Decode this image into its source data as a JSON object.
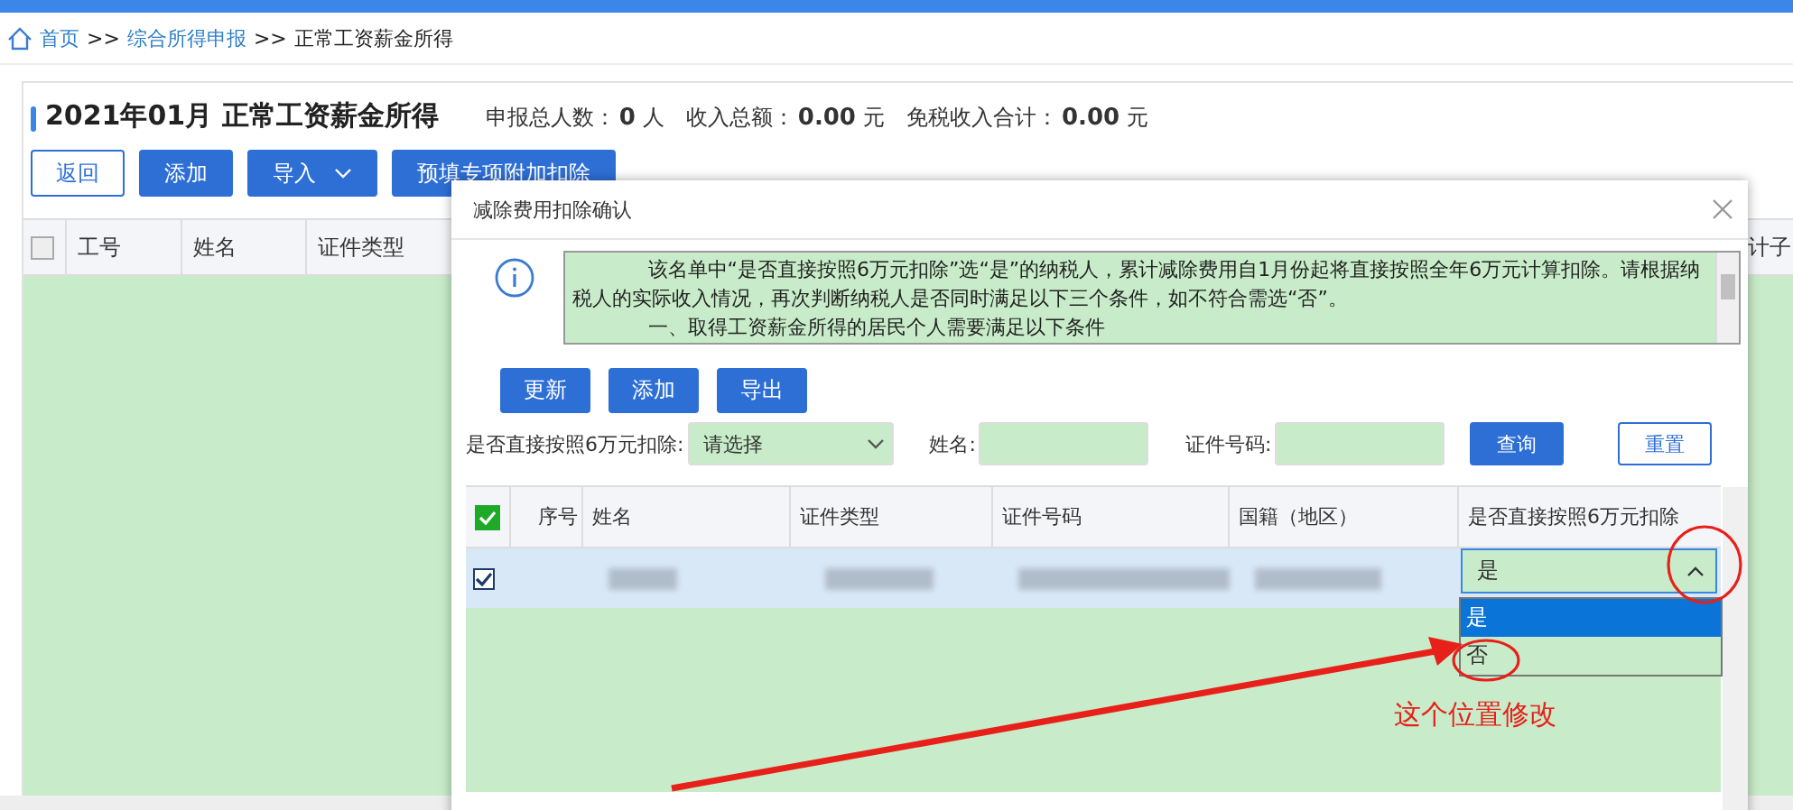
{
  "breadcrumb": [
    {
      "label": "首页",
      "kind": "link"
    },
    {
      "label": ">>",
      "kind": "sep"
    },
    {
      "label": "综合所得申报",
      "kind": "link"
    },
    {
      "label": ">>",
      "kind": "sep"
    },
    {
      "label": "正常工资薪金所得",
      "kind": "current"
    }
  ],
  "header": {
    "title": "2021年01月 正常工资薪金所得",
    "stats": [
      {
        "label": "申报总人数：",
        "value": "0",
        "unit": "人"
      },
      {
        "label": "收入总额：",
        "value": "0.00",
        "unit": "元"
      },
      {
        "label": "免税收入合计：",
        "value": "0.00",
        "unit": "元"
      }
    ]
  },
  "toolbar": [
    {
      "label": "返回",
      "kind": "outline"
    },
    {
      "label": "添加",
      "kind": "primary"
    },
    {
      "label": "导入",
      "kind": "dropdown"
    },
    {
      "label": "预填专项附加扣除",
      "kind": "primary"
    }
  ],
  "table": {
    "select_all_checked": false,
    "columns": [
      "工号",
      "姓名",
      "证件类型"
    ],
    "column_right": "计子"
  },
  "dialog": {
    "title": "减除费用扣除确认",
    "notice": "该名单中“是否直接按照6万元扣除”选“是”的纳税人，累计减除费用自1月份起将直接按照全年6万元计算扣除。请根据纳税人的实际收入情况，再次判断纳税人是否同时满足以下三个条件，如不符合需选“否”。",
    "notice_line_2": "一、取得工资薪金所得的居民个人需要满足以下条件",
    "buttons": [
      "更新",
      "添加",
      "导出"
    ],
    "filters": {
      "deduct_label": "是否直接按照6万元扣除:",
      "deduct_placeholder": "请选择",
      "name_label": "姓名:",
      "id_label": "证件号码:"
    },
    "filter_buttons": [
      {
        "label": "查询",
        "kind": "primary"
      },
      {
        "label": "重置",
        "kind": "outline"
      }
    ],
    "table": {
      "select_all_checked": true,
      "columns": [
        "序号",
        "姓名",
        "证件类型",
        "证件号码",
        "国籍（地区）",
        "是否直接按照6万元扣除"
      ],
      "rows": [
        {
          "checked": true,
          "deduct_value": "是",
          "dropdown_expanded": true,
          "options": [
            {
              "label": "是",
              "selected": true
            },
            {
              "label": "否",
              "selected": false
            }
          ]
        }
      ]
    }
  },
  "annotation": {
    "text": "这个位置修改"
  }
}
